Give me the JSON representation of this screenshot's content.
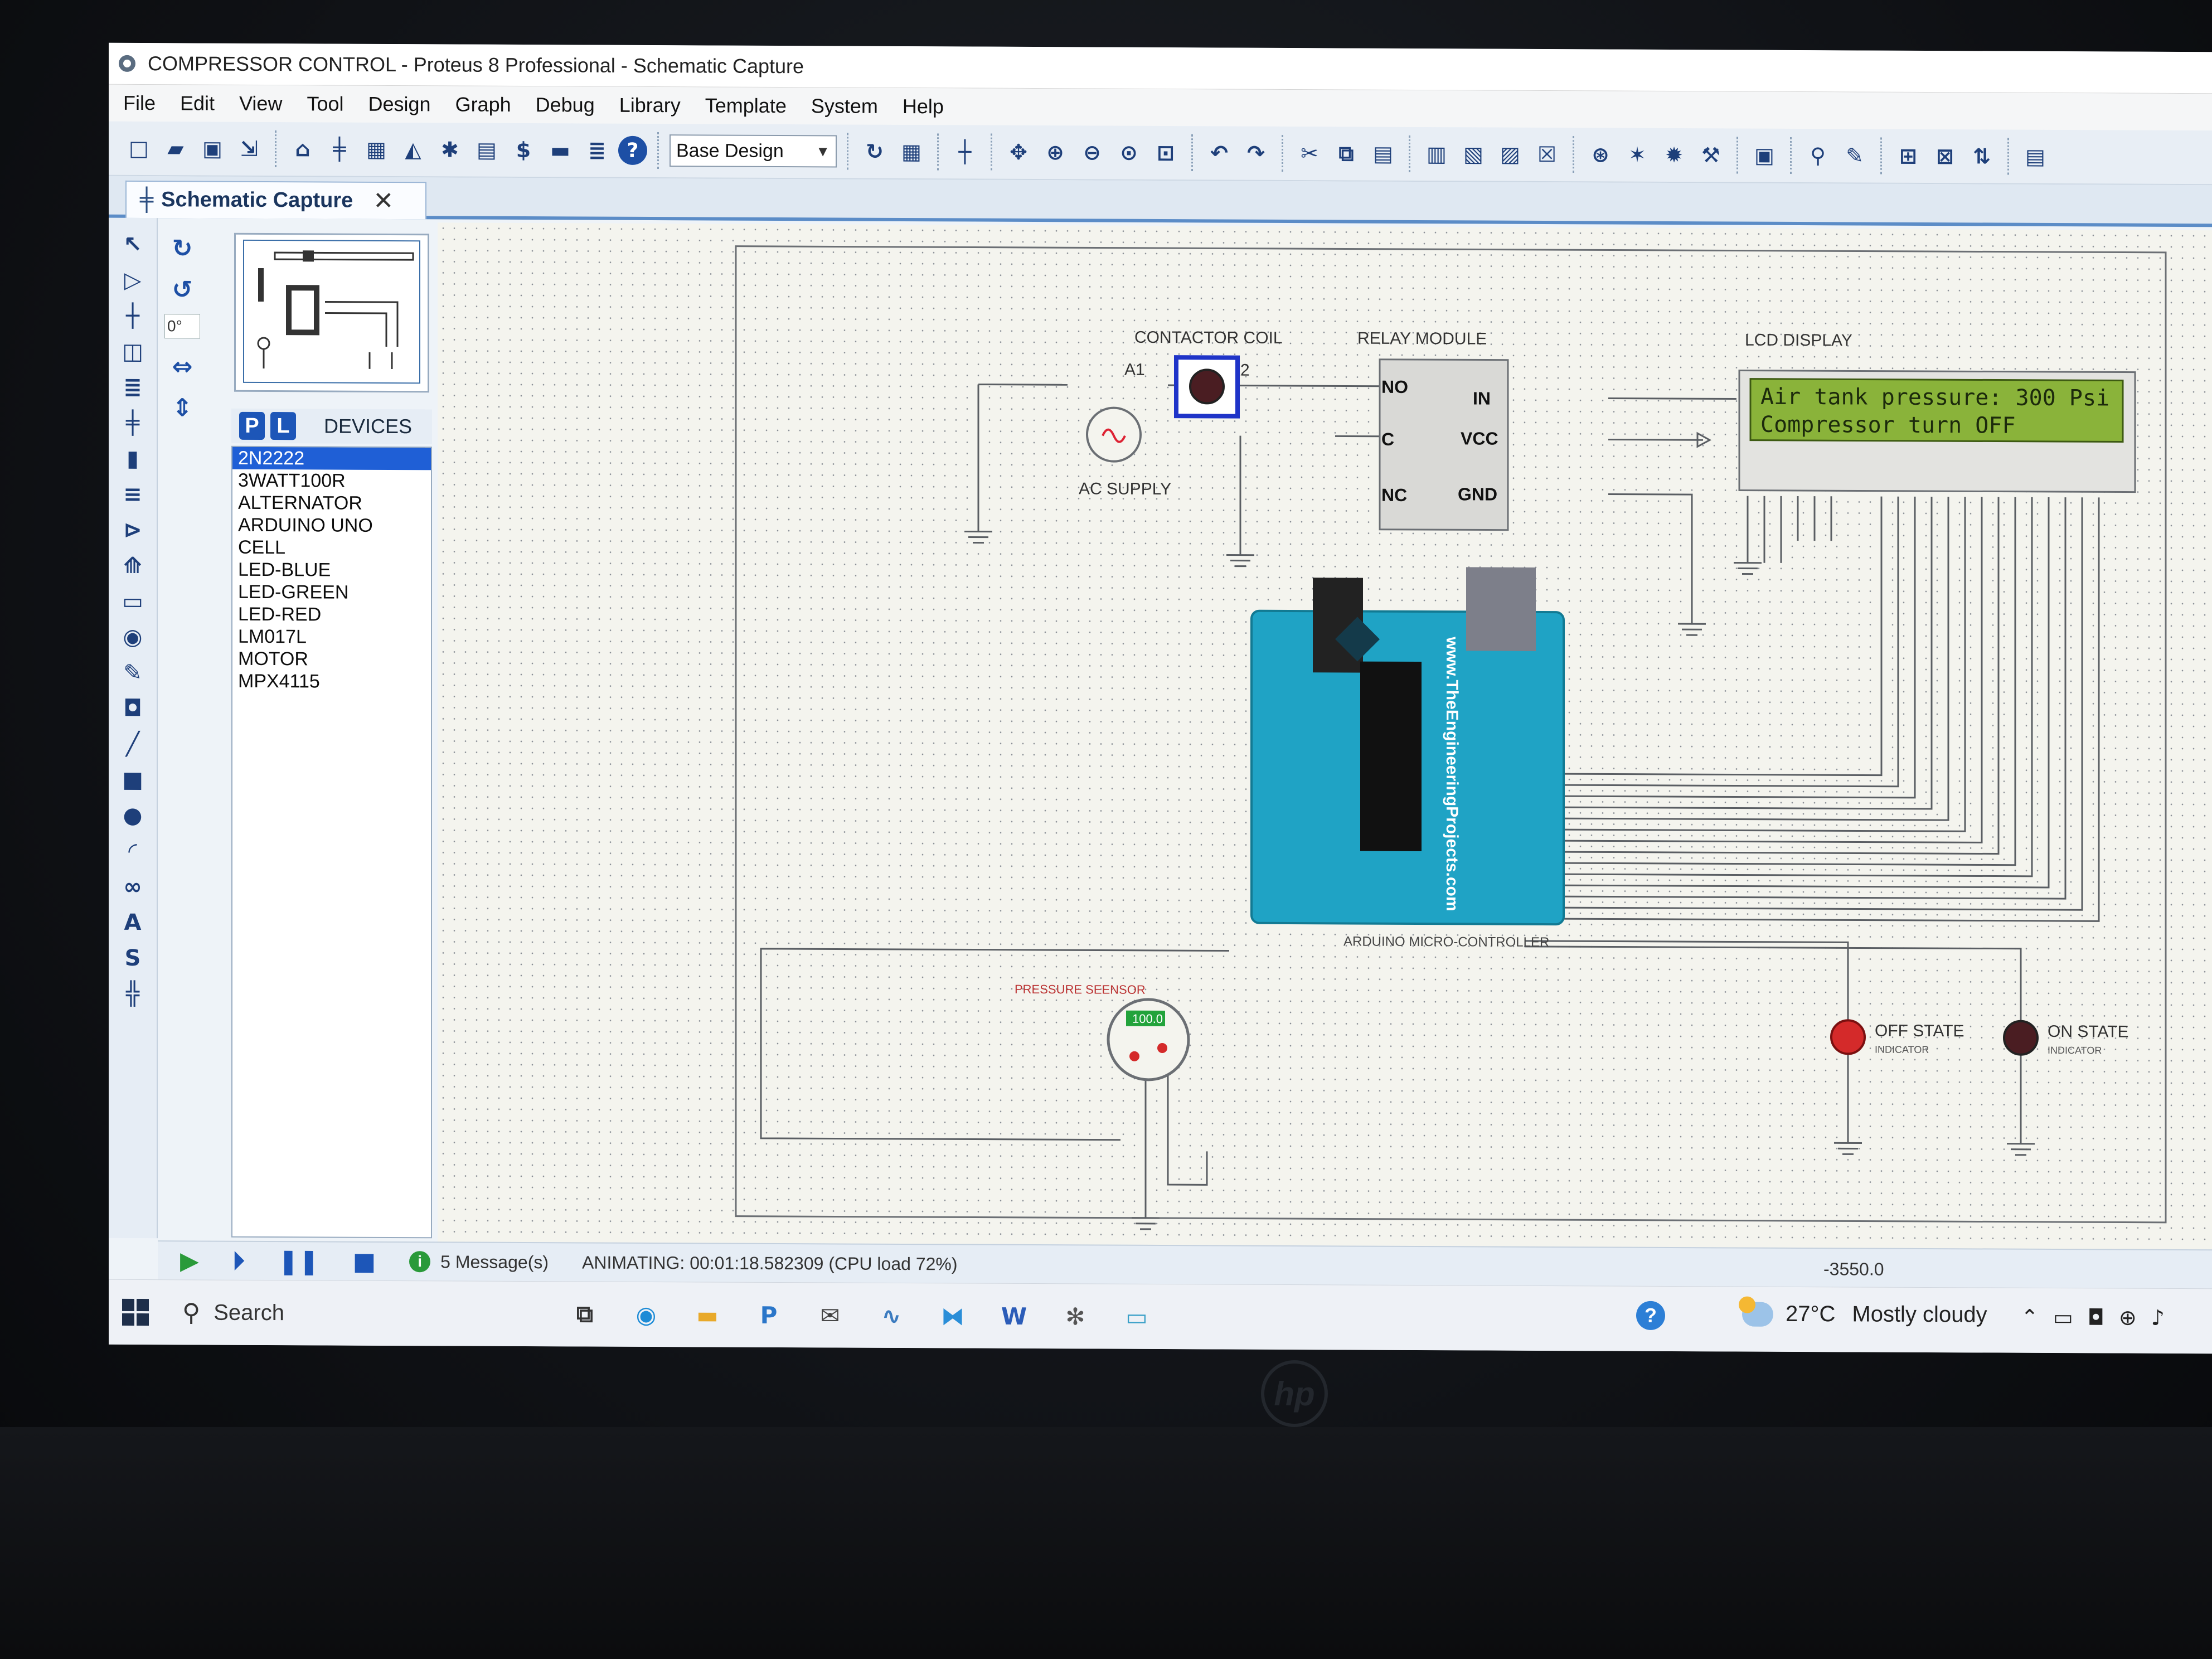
{
  "window": {
    "title": "COMPRESSOR CONTROL - Proteus 8 Professional - Schematic Capture"
  },
  "menu": [
    "File",
    "Edit",
    "View",
    "Tool",
    "Design",
    "Graph",
    "Debug",
    "Library",
    "Template",
    "System",
    "Help"
  ],
  "toolbar": {
    "design_select": "Base Design"
  },
  "tab": {
    "label": "Schematic Capture"
  },
  "rotation": {
    "angle": "0°"
  },
  "devices": {
    "pick_label": "P",
    "lib_label": "L",
    "title": "DEVICES",
    "items": [
      "2N2222",
      "3WATT100R",
      "ALTERNATOR",
      "ARDUINO UNO",
      "CELL",
      "LED-BLUE",
      "LED-GREEN",
      "LED-RED",
      "LM017L",
      "MOTOR",
      "MPX4115"
    ],
    "selected": "2N2222"
  },
  "schematic": {
    "contactor_label": "CONTACTOR COIL",
    "a1": "A1",
    "a2": "A2",
    "ac_supply": "AC SUPPLY",
    "relay_label": "RELAY MODULE",
    "relay_pins": {
      "no": "NO",
      "c": "C",
      "nc": "NC",
      "in": "IN",
      "vcc": "VCC",
      "gnd": "GND"
    },
    "lcd_label": "LCD DISPLAY",
    "lcd_line1": "Air tank pressure: 300 Psi",
    "lcd_line2": "Compressor turn OFF",
    "arduino_label": "ARDUINO MICRO-CONTROLLER",
    "arduino_site": "www.TheEngineeringProjects.com",
    "pressure_label": "PRESSURE SEENSOR",
    "pressure_reading": "100.0",
    "off_state": "OFF STATE",
    "on_state": "ON STATE",
    "indicator": "INDICATOR"
  },
  "status": {
    "messages": "5 Message(s)",
    "animating": "ANIMATING: 00:01:18.582309 (CPU load 72%)",
    "coordinate": "-3550.0"
  },
  "taskbar": {
    "search": "Search",
    "temperature": "27°C",
    "weather": "Mostly cloudy"
  },
  "colors": {
    "lcd_bg": "#8ab33a",
    "arduino": "#1fa3c5",
    "selection": "#1f5fd6",
    "led_red": "#d42a2a"
  }
}
